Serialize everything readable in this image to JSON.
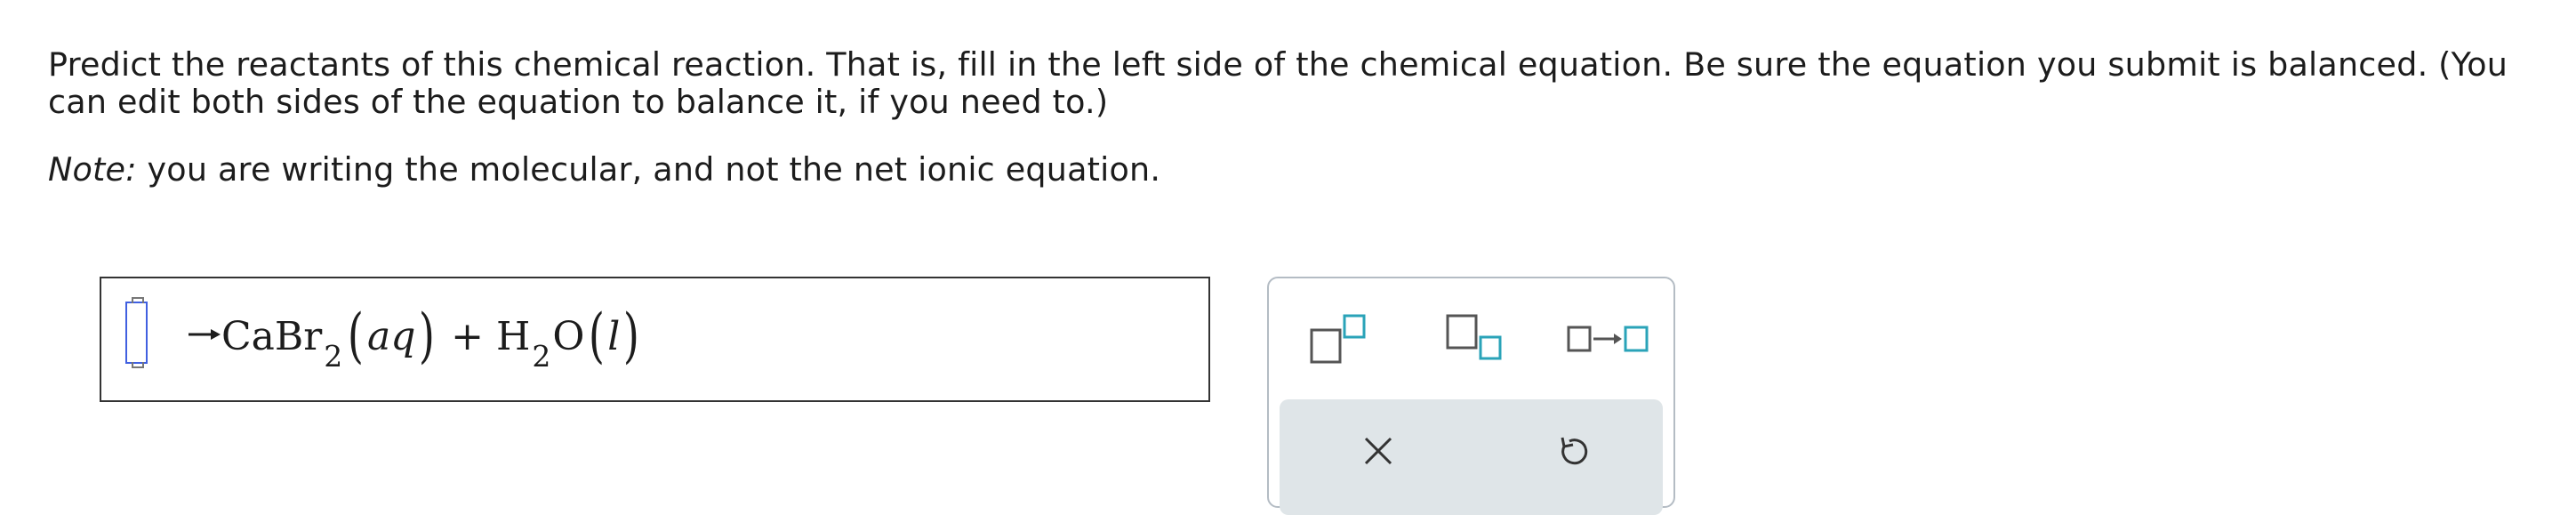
{
  "instructions": {
    "prompt": "Predict the reactants of this chemical reaction. That is, fill in the left side of the chemical equation. Be sure the equation you submit is balanced. (You can edit both sides of the equation to balance it, if you need to.)",
    "note_label": "Note:",
    "note_text": " you are writing the molecular, and not the net ionic equation."
  },
  "equation": {
    "product1_formula": "CaBr",
    "product1_subscript": "2",
    "product1_open_paren": "(",
    "product1_state": "aq",
    "product1_close_paren": ")",
    "plus": "+",
    "product2_h": "H",
    "product2_subscript": "2",
    "product2_o": "O",
    "product2_open_paren": "(",
    "product2_state": "l",
    "product2_close_paren": ")"
  },
  "palette": {
    "accent_color": "#2aa3b8",
    "tools": [
      {
        "icon": "superscript-icon"
      },
      {
        "icon": "subscript-icon"
      },
      {
        "icon": "reaction-arrow-icon"
      }
    ],
    "actions": [
      {
        "icon": "close-icon"
      },
      {
        "icon": "undo-icon"
      }
    ]
  }
}
